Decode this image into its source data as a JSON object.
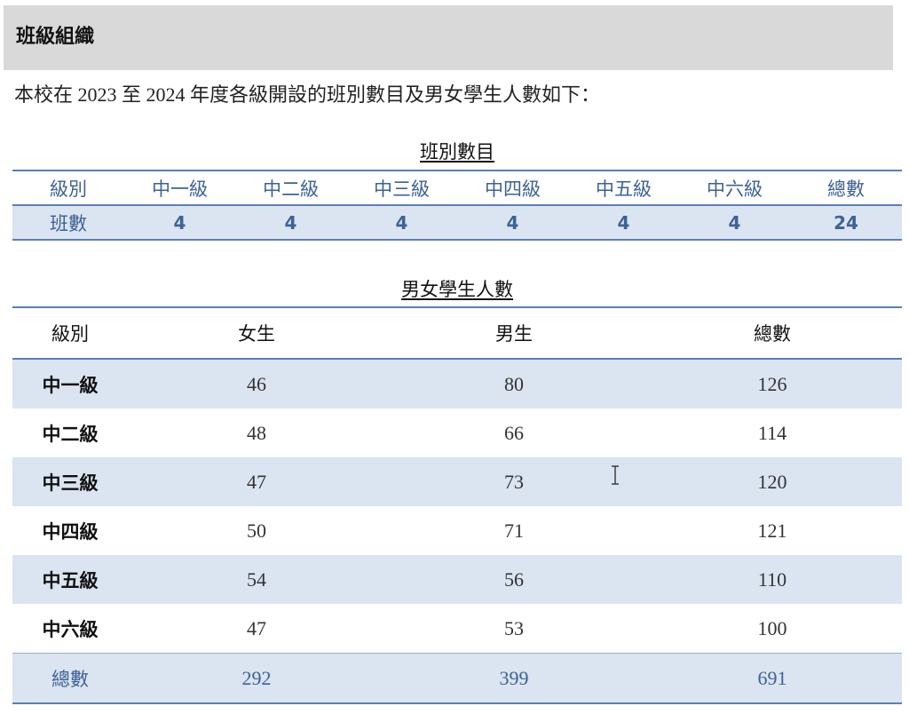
{
  "section": {
    "title": "班級組織"
  },
  "intro": "本校在 2023 至 2024 年度各級開設的班別數目及男女學生人數如下：",
  "class_table": {
    "caption": "班別數目",
    "headers": [
      "級別",
      "中一級",
      "中二級",
      "中三級",
      "中四級",
      "中五級",
      "中六級",
      "總數"
    ],
    "row_label": "班數",
    "values": [
      "4",
      "4",
      "4",
      "4",
      "4",
      "4",
      "24"
    ]
  },
  "student_table": {
    "caption": "男女學生人數",
    "headers": [
      "級別",
      "女生",
      "男生",
      "總數"
    ],
    "rows": [
      {
        "grade": "中一級",
        "female": "46",
        "male": "80",
        "total": "126"
      },
      {
        "grade": "中二級",
        "female": "48",
        "male": "66",
        "total": "114"
      },
      {
        "grade": "中三級",
        "female": "47",
        "male": "73",
        "total": "120"
      },
      {
        "grade": "中四級",
        "female": "50",
        "male": "71",
        "total": "121"
      },
      {
        "grade": "中五級",
        "female": "54",
        "male": "56",
        "total": "110"
      },
      {
        "grade": "中六級",
        "female": "47",
        "male": "53",
        "total": "100"
      }
    ],
    "totals": {
      "label": "總數",
      "female": "292",
      "male": "399",
      "total": "691"
    }
  },
  "colors": {
    "accent": "#3d6296",
    "rule": "#5b7fb2",
    "row_shade": "#dbe4f1",
    "header_band": "#d9d9d9"
  },
  "icons": {
    "cursor": "text-cursor-icon"
  }
}
